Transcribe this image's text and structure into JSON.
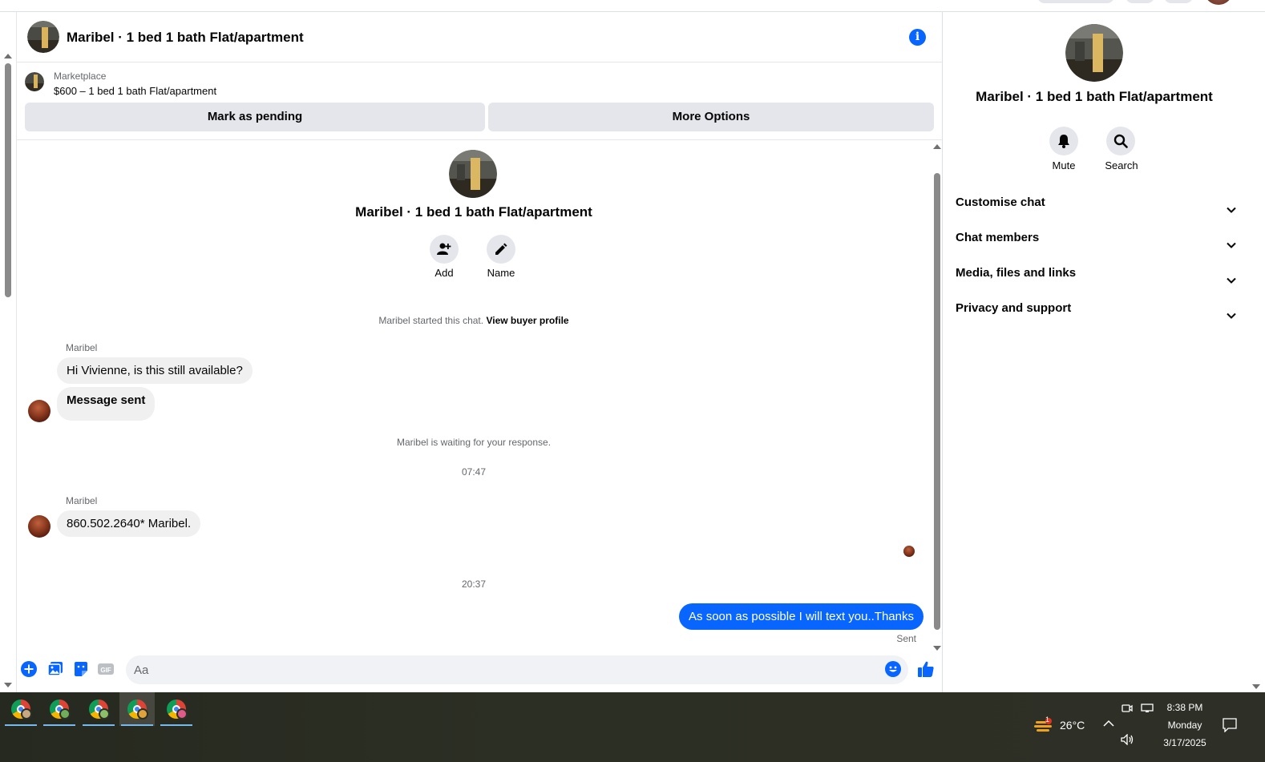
{
  "header": {
    "title": "Maribel · 1 bed 1 bath Flat/apartment"
  },
  "listing": {
    "source": "Marketplace",
    "price_line": "$600 – 1 bed 1 bath Flat/apartment",
    "mark_pending": "Mark as pending",
    "more_options": "More Options"
  },
  "chat_intro": {
    "title": "Maribel · 1 bed 1 bath Flat/apartment",
    "add_label": "Add",
    "name_label": "Name",
    "started_text": "Maribel started this chat.",
    "view_profile": "View buyer profile"
  },
  "messages": [
    {
      "sender": "Maribel",
      "text": "Hi Vivienne, is this still available?"
    },
    {
      "text": "Message sent"
    },
    {
      "system": "Maribel is waiting for your response."
    },
    {
      "time": "07:47"
    },
    {
      "sender": "Maribel",
      "text": "860.502.2640* Maribel."
    },
    {
      "time": "20:37"
    },
    {
      "outgoing": "As soon as possible I will text you..Thanks",
      "status": "Sent"
    }
  ],
  "composer": {
    "placeholder": "Aa"
  },
  "side_panel": {
    "title": "Maribel · 1 bed 1 bath Flat/apartment",
    "mute": "Mute",
    "search": "Search",
    "sections": [
      "Customise chat",
      "Chat members",
      "Media, files and links",
      "Privacy and support"
    ]
  },
  "taskbar": {
    "temperature": "26°C",
    "weather_badge": "1",
    "time": "8:38 PM",
    "day": "Monday",
    "date": "3/17/2025"
  },
  "colors": {
    "accent": "#0866ff",
    "bubble_gray": "#f0f0f0",
    "button_gray": "#e4e6eb"
  }
}
